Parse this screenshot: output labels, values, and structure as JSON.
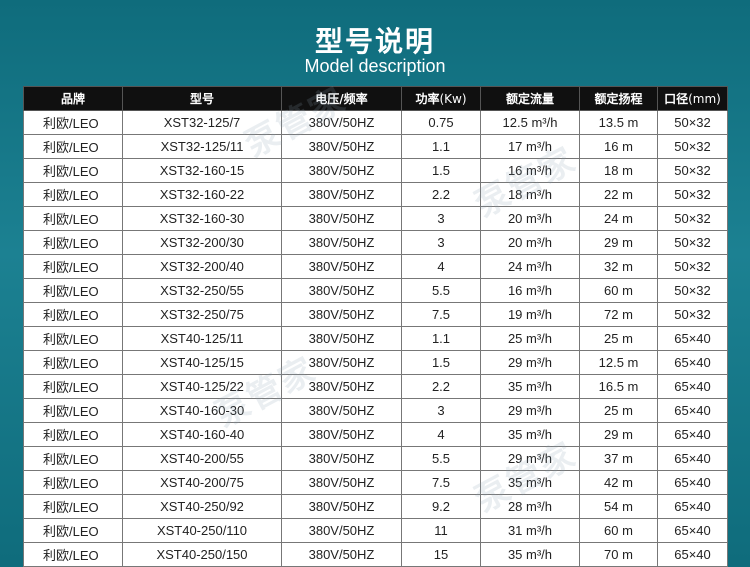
{
  "header": {
    "title": "型号说明",
    "subtitle": "Model description"
  },
  "table": {
    "columns": [
      {
        "label": "品牌",
        "unit": ""
      },
      {
        "label": "型号",
        "unit": ""
      },
      {
        "label": "电压/频率",
        "unit": ""
      },
      {
        "label": "功率",
        "unit": "(Kw)"
      },
      {
        "label": "额定流量",
        "unit": ""
      },
      {
        "label": "额定扬程",
        "unit": ""
      },
      {
        "label": "口径",
        "unit": "(mm)"
      }
    ],
    "rows": [
      [
        "利欧/LEO",
        "XST32-125/7",
        "380V/50HZ",
        "0.75",
        "12.5 m³/h",
        "13.5 m",
        "50×32"
      ],
      [
        "利欧/LEO",
        "XST32-125/11",
        "380V/50HZ",
        "1.1",
        "17 m³/h",
        "16 m",
        "50×32"
      ],
      [
        "利欧/LEO",
        "XST32-160-15",
        "380V/50HZ",
        "1.5",
        "16 m³/h",
        "18 m",
        "50×32"
      ],
      [
        "利欧/LEO",
        "XST32-160-22",
        "380V/50HZ",
        "2.2",
        "18 m³/h",
        "22 m",
        "50×32"
      ],
      [
        "利欧/LEO",
        "XST32-160-30",
        "380V/50HZ",
        "3",
        "20 m³/h",
        "24 m",
        "50×32"
      ],
      [
        "利欧/LEO",
        "XST32-200/30",
        "380V/50HZ",
        "3",
        "20 m³/h",
        "29 m",
        "50×32"
      ],
      [
        "利欧/LEO",
        "XST32-200/40",
        "380V/50HZ",
        "4",
        "24 m³/h",
        "32 m",
        "50×32"
      ],
      [
        "利欧/LEO",
        "XST32-250/55",
        "380V/50HZ",
        "5.5",
        "16 m³/h",
        "60 m",
        "50×32"
      ],
      [
        "利欧/LEO",
        "XST32-250/75",
        "380V/50HZ",
        "7.5",
        "19 m³/h",
        "72 m",
        "50×32"
      ],
      [
        "利欧/LEO",
        "XST40-125/11",
        "380V/50HZ",
        "1.1",
        "25 m³/h",
        "25 m",
        "65×40"
      ],
      [
        "利欧/LEO",
        "XST40-125/15",
        "380V/50HZ",
        "1.5",
        "29 m³/h",
        "12.5 m",
        "65×40"
      ],
      [
        "利欧/LEO",
        "XST40-125/22",
        "380V/50HZ",
        "2.2",
        "35 m³/h",
        "16.5 m",
        "65×40"
      ],
      [
        "利欧/LEO",
        "XST40-160-30",
        "380V/50HZ",
        "3",
        "29 m³/h",
        "25 m",
        "65×40"
      ],
      [
        "利欧/LEO",
        "XST40-160-40",
        "380V/50HZ",
        "4",
        "35 m³/h",
        "29 m",
        "65×40"
      ],
      [
        "利欧/LEO",
        "XST40-200/55",
        "380V/50HZ",
        "5.5",
        "29 m³/h",
        "37 m",
        "65×40"
      ],
      [
        "利欧/LEO",
        "XST40-200/75",
        "380V/50HZ",
        "7.5",
        "35 m³/h",
        "42 m",
        "65×40"
      ],
      [
        "利欧/LEO",
        "XST40-250/92",
        "380V/50HZ",
        "9.2",
        "28 m³/h",
        "54 m",
        "65×40"
      ],
      [
        "利欧/LEO",
        "XST40-250/110",
        "380V/50HZ",
        "11",
        "31 m³/h",
        "60 m",
        "65×40"
      ],
      [
        "利欧/LEO",
        "XST40-250/150",
        "380V/50HZ",
        "15",
        "35 m³/h",
        "70 m",
        "65×40"
      ]
    ]
  },
  "watermark": {
    "text": "泵管家"
  }
}
